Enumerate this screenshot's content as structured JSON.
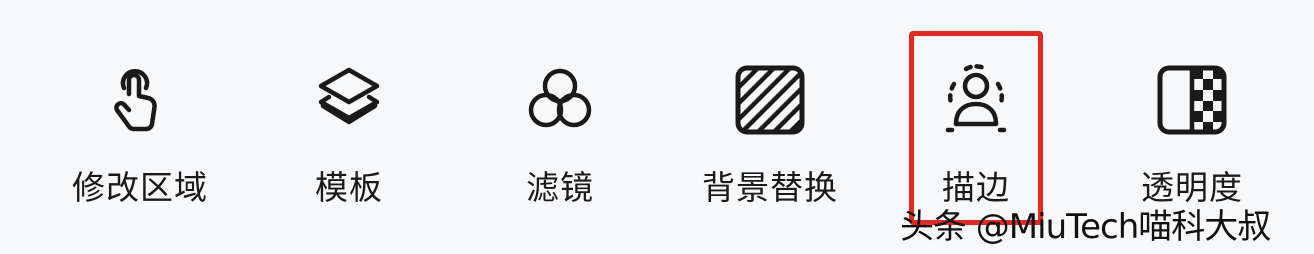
{
  "toolbar": {
    "items": [
      {
        "label": "修改区域",
        "icon": "tap-hand-icon"
      },
      {
        "label": "模板",
        "icon": "layers-icon"
      },
      {
        "label": "滤镜",
        "icon": "filter-circles-icon"
      },
      {
        "label": "背景替换",
        "icon": "striped-square-icon"
      },
      {
        "label": "描边",
        "icon": "person-outline-icon"
      },
      {
        "label": "透明度",
        "icon": "transparency-checker-icon"
      }
    ],
    "highlighted_item": "描边"
  },
  "colors": {
    "highlight": "#e8271f",
    "icon_stroke": "#1a1a1a",
    "background": "#f7f8fa"
  },
  "watermark": {
    "text": "头条 @MiuTech喵科大叔"
  }
}
